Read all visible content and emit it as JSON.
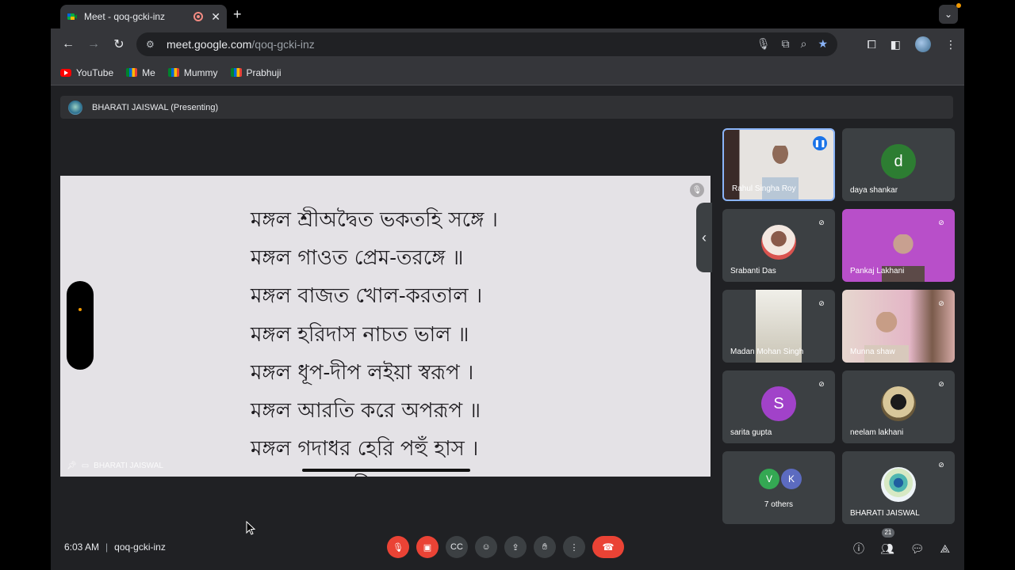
{
  "browser": {
    "tab_title": "Meet - qoq-gcki-inz",
    "new_tab": "+",
    "tab_menu": "⌄",
    "url_host": "meet.google.com",
    "url_path": "/qoq-gcki-inz",
    "bookmarks": [
      {
        "label": "YouTube",
        "icon": "youtube-icon"
      },
      {
        "label": "Me",
        "icon": "meet-icon"
      },
      {
        "label": "Mummy",
        "icon": "meet-icon"
      },
      {
        "label": "Prabhuji",
        "icon": "meet-icon"
      }
    ]
  },
  "meet": {
    "presenter_bar": "BHARATI JAISWAL (Presenting)",
    "presentation_label": "BHARATI JAISWAL",
    "presentation_lines": [
      "মঙ্গল শ্রীঅদ্বৈত ভকতহি সঙ্গে ।",
      "মঙ্গল গাওত প্রেম-তরঙ্গে ॥",
      "মঙ্গল বাজত খোল-করতাল ।",
      "মঙ্গল হরিদাস নাচত ভাল ॥",
      "মঙ্গল ধূপ-দীপ লইয়া স্বরূপ ।",
      "মঙ্গল আরতি করে অপরূপ ॥",
      "মঙ্গল গদাধর হেরি পহুঁ হাস ।",
      "মঙ্গল গাওত দীন কৃষ্ণদাস ॥"
    ],
    "participants": [
      {
        "name": "Rahul Singha Roy"
      },
      {
        "name": "daya shankar",
        "initial": "d",
        "color": "#2d7d32"
      },
      {
        "name": "Srabanti Das"
      },
      {
        "name": "Pankaj Lakhani"
      },
      {
        "name": "Madan Mohan Singh"
      },
      {
        "name": "Munna shaw"
      },
      {
        "name": "sarita gupta",
        "initial": "S",
        "color": "#a142c9"
      },
      {
        "name": "neelam lakhani"
      },
      {
        "others_label": "7 others",
        "initials": [
          "V",
          "K"
        ],
        "colors": [
          "#34a853",
          "#5c6bc0"
        ]
      },
      {
        "name": "BHARATI JAISWAL"
      }
    ],
    "time": "6:03 AM",
    "meeting_code": "qoq-gcki-inz",
    "people_count": "21"
  }
}
